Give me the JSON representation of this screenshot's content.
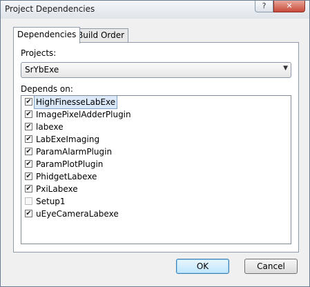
{
  "window": {
    "title": "Project Dependencies"
  },
  "titlebar": {
    "help_glyph": "?",
    "close_glyph": "✕"
  },
  "tabs": [
    {
      "label": "Dependencies",
      "active": true
    },
    {
      "label": "Build Order",
      "active": false
    }
  ],
  "projects": {
    "label": "Projects:",
    "selected": "SrYbExe",
    "arrow": "▼"
  },
  "depends_on": {
    "label": "Depends on:",
    "items": [
      {
        "label": "HighFinesseLabExe",
        "checked": true,
        "selected": true
      },
      {
        "label": "ImagePixelAdderPlugin",
        "checked": true
      },
      {
        "label": "labexe",
        "checked": true
      },
      {
        "label": "LabExeImaging",
        "checked": true
      },
      {
        "label": "ParamAlarmPlugin",
        "checked": true
      },
      {
        "label": "ParamPlotPlugin",
        "checked": true
      },
      {
        "label": "PhidgetLabexe",
        "checked": true
      },
      {
        "label": "PxiLabexe",
        "checked": true
      },
      {
        "label": "Setup1",
        "checked": false
      },
      {
        "label": "uEyeCameraLabexe",
        "checked": true
      }
    ]
  },
  "buttons": {
    "ok": "OK",
    "cancel": "Cancel"
  },
  "colors": {
    "selection": "#dbe8f7",
    "default_button": "#bee6fd",
    "close_button": "#c74a3a"
  }
}
